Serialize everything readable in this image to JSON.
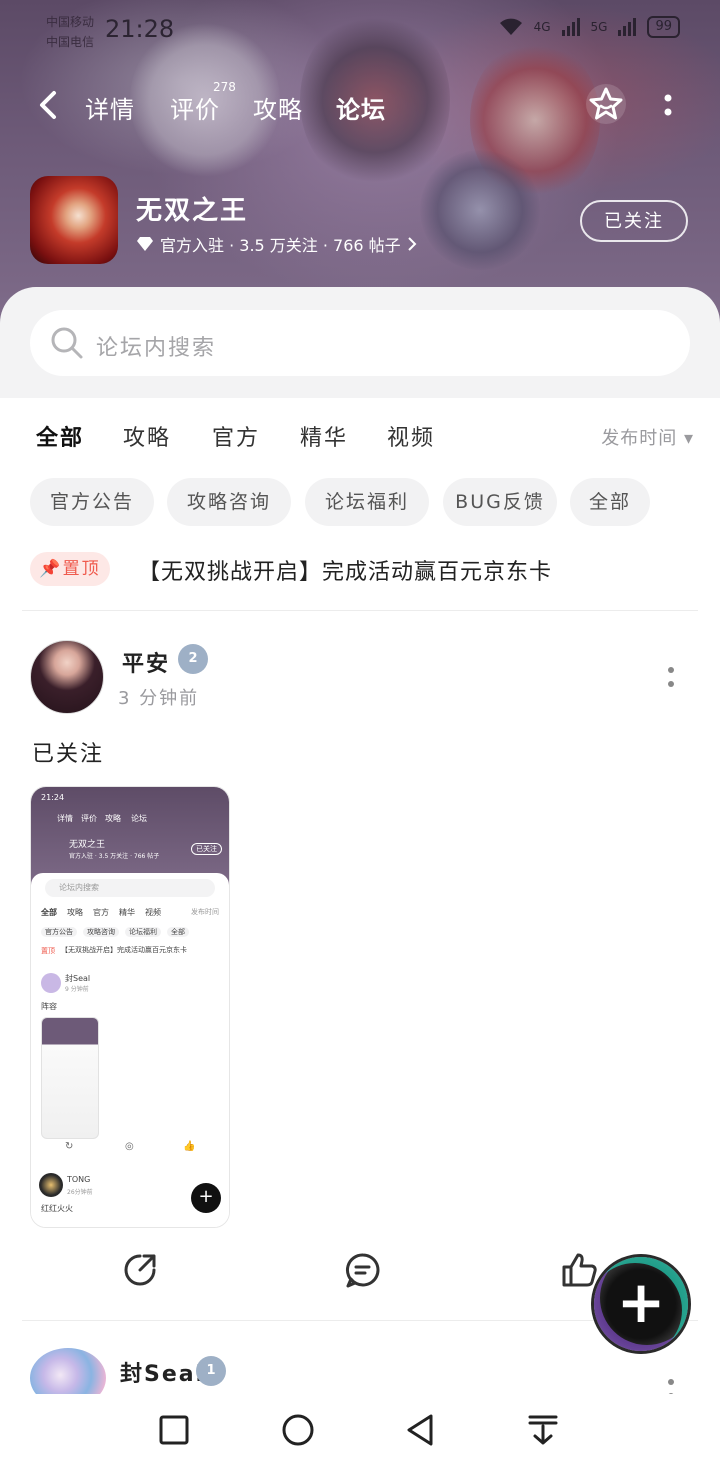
{
  "status_bar": {
    "carrier1": "中国移动",
    "carrier2": "中国电信",
    "time": "21:28",
    "net1": "4G",
    "net2": "5G",
    "battery": "99"
  },
  "top_nav": {
    "tabs": [
      {
        "label": "详情",
        "active": false
      },
      {
        "label": "评价",
        "active": false,
        "count": "278"
      },
      {
        "label": "攻略",
        "active": false
      },
      {
        "label": "论坛",
        "active": true
      }
    ]
  },
  "game": {
    "name": "无双之王",
    "meta": "官方入驻 · 3.5 万关注 · 766 帖子",
    "follow_label": "已关注"
  },
  "search": {
    "placeholder": "论坛内搜索"
  },
  "categories": [
    "全部",
    "攻略",
    "官方",
    "精华",
    "视频"
  ],
  "sort_label": "发布时间",
  "chips": [
    "官方公告",
    "攻略咨询",
    "论坛福利",
    "BUG反馈",
    "全部"
  ],
  "pinned": {
    "badge": "置顶",
    "title": "【无双挑战开启】完成活动赢百元京东卡"
  },
  "post1": {
    "author": "平安",
    "level": "2",
    "time": "3 分钟前",
    "text": "已关注",
    "screenshot": {
      "time": "21:24",
      "tabs": [
        "详情",
        "评价",
        "攻略",
        "论坛"
      ],
      "game": "无双之王",
      "meta": "官方入驻 · 3.5 万关注 · 766 帖子",
      "follow": "已关注",
      "search": "论坛内搜索",
      "cats": [
        "全部",
        "攻略",
        "官方",
        "精华",
        "视频"
      ],
      "sort": "发布时间",
      "chips": [
        "官方公告",
        "攻略咨询",
        "论坛福利",
        "全部"
      ],
      "pinned": "【无双挑战开启】完成活动赢百元京东卡",
      "pinned_badge": "置顶",
      "post_author": "封Seal",
      "post_time": "9 分钟前",
      "post_text": "阵容",
      "post2_author": "TONG",
      "post2_time": "26分钟前",
      "post2_text": "红红火火"
    }
  },
  "post2": {
    "author": "封Seal",
    "level": "1"
  },
  "colors": {
    "accent": "#22d3b6",
    "pin": "#ef5a4d",
    "banner": "#6d5a78"
  },
  "icons": [
    "back-arrow-icon",
    "star-icon",
    "more-icon",
    "search-icon",
    "diamond-icon",
    "share-icon",
    "comment-icon",
    "like-icon",
    "plus-icon",
    "pin-icon",
    "square-icon",
    "circle-icon",
    "triangle-back-icon",
    "download-icon"
  ]
}
